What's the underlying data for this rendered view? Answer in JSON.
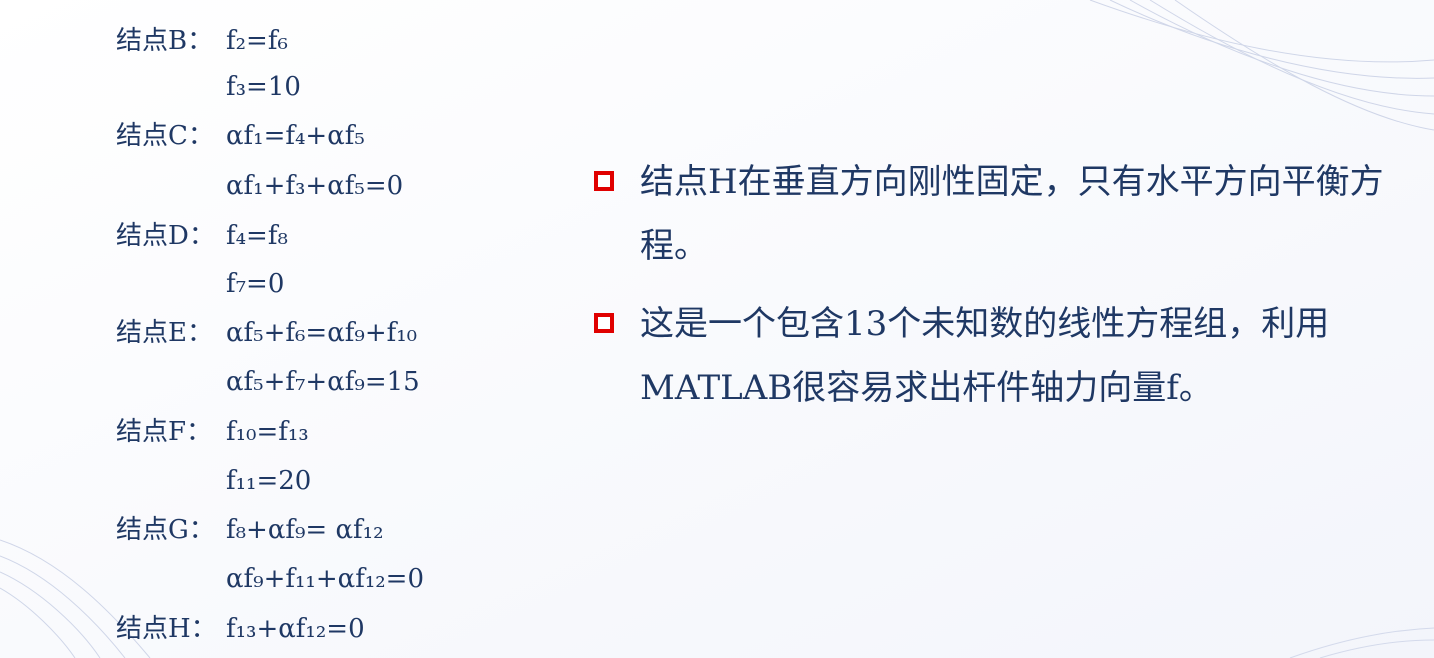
{
  "colors": {
    "text": "#1f3864",
    "bullet_border": "#e00000",
    "wave": "#aeb9d8"
  },
  "equations": [
    {
      "label": "结点B：",
      "expr": "f₂=f₆"
    },
    {
      "label": "",
      "expr": "f₃=10"
    },
    {
      "label": "结点C：",
      "expr": "αf₁=f₄+αf₅"
    },
    {
      "label": "",
      "expr": "αf₁+f₃+αf₅=0"
    },
    {
      "label": "结点D：",
      "expr": "f₄=f₈"
    },
    {
      "label": "",
      "expr": "f₇=0"
    },
    {
      "label": "结点E：",
      "expr": "αf₅+f₆=αf₉+f₁₀"
    },
    {
      "label": "",
      "expr": "αf₅+f₇+αf₉=15"
    },
    {
      "label": "结点F：",
      "expr": "f₁₀=f₁₃"
    },
    {
      "label": "",
      "expr": "f₁₁=20"
    },
    {
      "label": "结点G：",
      "expr": "f₈+αf₉= αf₁₂"
    },
    {
      "label": "",
      "expr": "αf₉+f₁₁+αf₁₂=0"
    },
    {
      "label": "结点H：",
      "expr": "f₁₃+αf₁₂=0"
    }
  ],
  "bullets": [
    {
      "text": "结点H在垂直方向刚性固定，只有水平方向平衡方程。"
    },
    {
      "text": "这是一个包含13个未知数的线性方程组，利用MATLAB很容易求出杆件轴力向量f。"
    }
  ]
}
